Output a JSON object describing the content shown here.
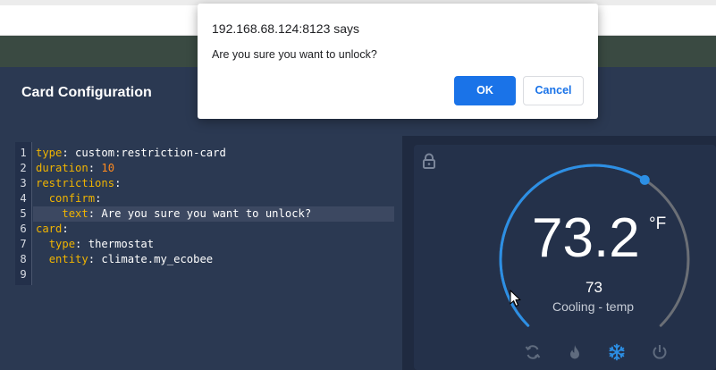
{
  "card": {
    "title": "Card Configuration"
  },
  "editor": {
    "lines": [
      {
        "n": "1",
        "tokens": [
          {
            "t": "type",
            "c": "key"
          },
          {
            "t": ": ",
            "c": "val"
          },
          {
            "t": "custom:restriction-card",
            "c": "val"
          }
        ]
      },
      {
        "n": "2",
        "tokens": [
          {
            "t": "duration",
            "c": "key"
          },
          {
            "t": ": ",
            "c": "val"
          },
          {
            "t": "10",
            "c": "num"
          }
        ]
      },
      {
        "n": "3",
        "tokens": [
          {
            "t": "restrictions",
            "c": "key"
          },
          {
            "t": ":",
            "c": "val"
          }
        ]
      },
      {
        "n": "4",
        "tokens": [
          {
            "t": "  ",
            "c": "val"
          },
          {
            "t": "confirm",
            "c": "key"
          },
          {
            "t": ":",
            "c": "val"
          }
        ]
      },
      {
        "n": "5",
        "active": true,
        "tokens": [
          {
            "t": "    ",
            "c": "val"
          },
          {
            "t": "text",
            "c": "key"
          },
          {
            "t": ": ",
            "c": "val"
          },
          {
            "t": "Are you sure you want to unlock?",
            "c": "val"
          }
        ]
      },
      {
        "n": "6",
        "tokens": [
          {
            "t": "card",
            "c": "key"
          },
          {
            "t": ":",
            "c": "val"
          }
        ]
      },
      {
        "n": "7",
        "tokens": [
          {
            "t": "  ",
            "c": "val"
          },
          {
            "t": "type",
            "c": "key"
          },
          {
            "t": ": ",
            "c": "val"
          },
          {
            "t": "thermostat",
            "c": "val"
          }
        ]
      },
      {
        "n": "8",
        "tokens": [
          {
            "t": "  ",
            "c": "val"
          },
          {
            "t": "entity",
            "c": "key"
          },
          {
            "t": ": ",
            "c": "val"
          },
          {
            "t": "climate.my_ecobee",
            "c": "val"
          }
        ]
      },
      {
        "n": "9",
        "tokens": []
      }
    ]
  },
  "thermostat": {
    "current_temp": "73.2",
    "unit": "°F",
    "target_temp": "73",
    "mode_label": "Cooling - temp",
    "dial_level": 0.62,
    "modes": [
      {
        "name": "auto-mode-icon",
        "active": false
      },
      {
        "name": "heat-mode-icon",
        "active": false
      },
      {
        "name": "cool-mode-icon",
        "active": true
      },
      {
        "name": "off-mode-icon",
        "active": false
      }
    ],
    "colors": {
      "accent": "#2c8fe5",
      "inactive_arc": "#6b6f76",
      "icon_inactive": "#5f6b7e"
    }
  },
  "dialog": {
    "origin": "192.168.68.124:8123 says",
    "message": "Are you sure you want to unlock?",
    "ok_label": "OK",
    "cancel_label": "Cancel",
    "accent": "#1a73e8"
  }
}
